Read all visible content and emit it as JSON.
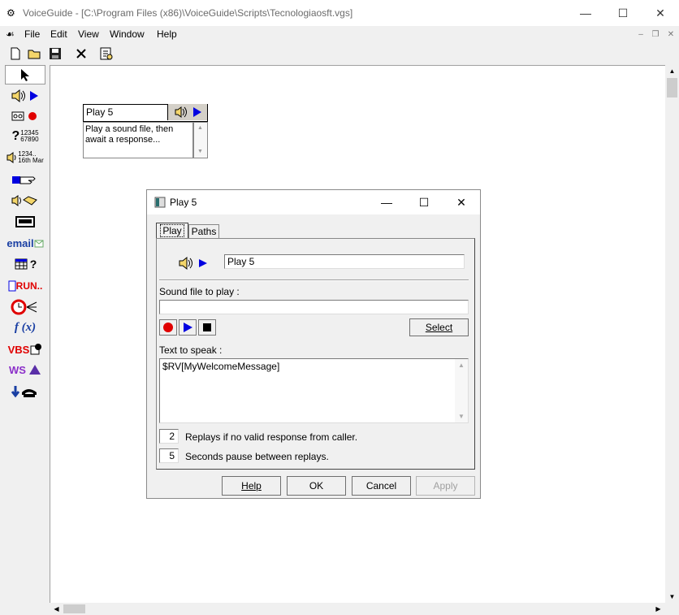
{
  "window": {
    "title": "VoiceGuide - [C:\\Program Files (x86)\\VoiceGuide\\Scripts\\Tecnologiaosft.vgs]"
  },
  "menu": [
    "File",
    "Edit",
    "View",
    "Window",
    "Help"
  ],
  "palette": {
    "numbers_label": "12345\n67890",
    "date_label": "1234..\n16th Mar",
    "email_label": "email",
    "run_label": "RUN..",
    "fx_label": "f (x)",
    "vbs_label": "VBS",
    "ws_label": "WS"
  },
  "node": {
    "title": "Play 5",
    "description": "Play a sound file, then await a response..."
  },
  "dialog": {
    "title": "Play 5",
    "tabs": [
      "Play",
      "Paths"
    ],
    "name_value": "Play 5",
    "sound_file_label": "Sound file to play :",
    "sound_file_value": "",
    "select_button": "Select",
    "text_to_speak_label": "Text to speak :",
    "text_to_speak_value": "$RV[MyWelcomeMessage]",
    "replays_value": "2",
    "replays_label": "Replays if no valid response from caller.",
    "pause_value": "5",
    "pause_label": "Seconds pause between replays.",
    "buttons": {
      "help": "Help",
      "ok": "OK",
      "cancel": "Cancel",
      "apply": "Apply"
    }
  },
  "colors": {
    "accent_blue": "#0000e0",
    "record_red": "#e00000"
  }
}
